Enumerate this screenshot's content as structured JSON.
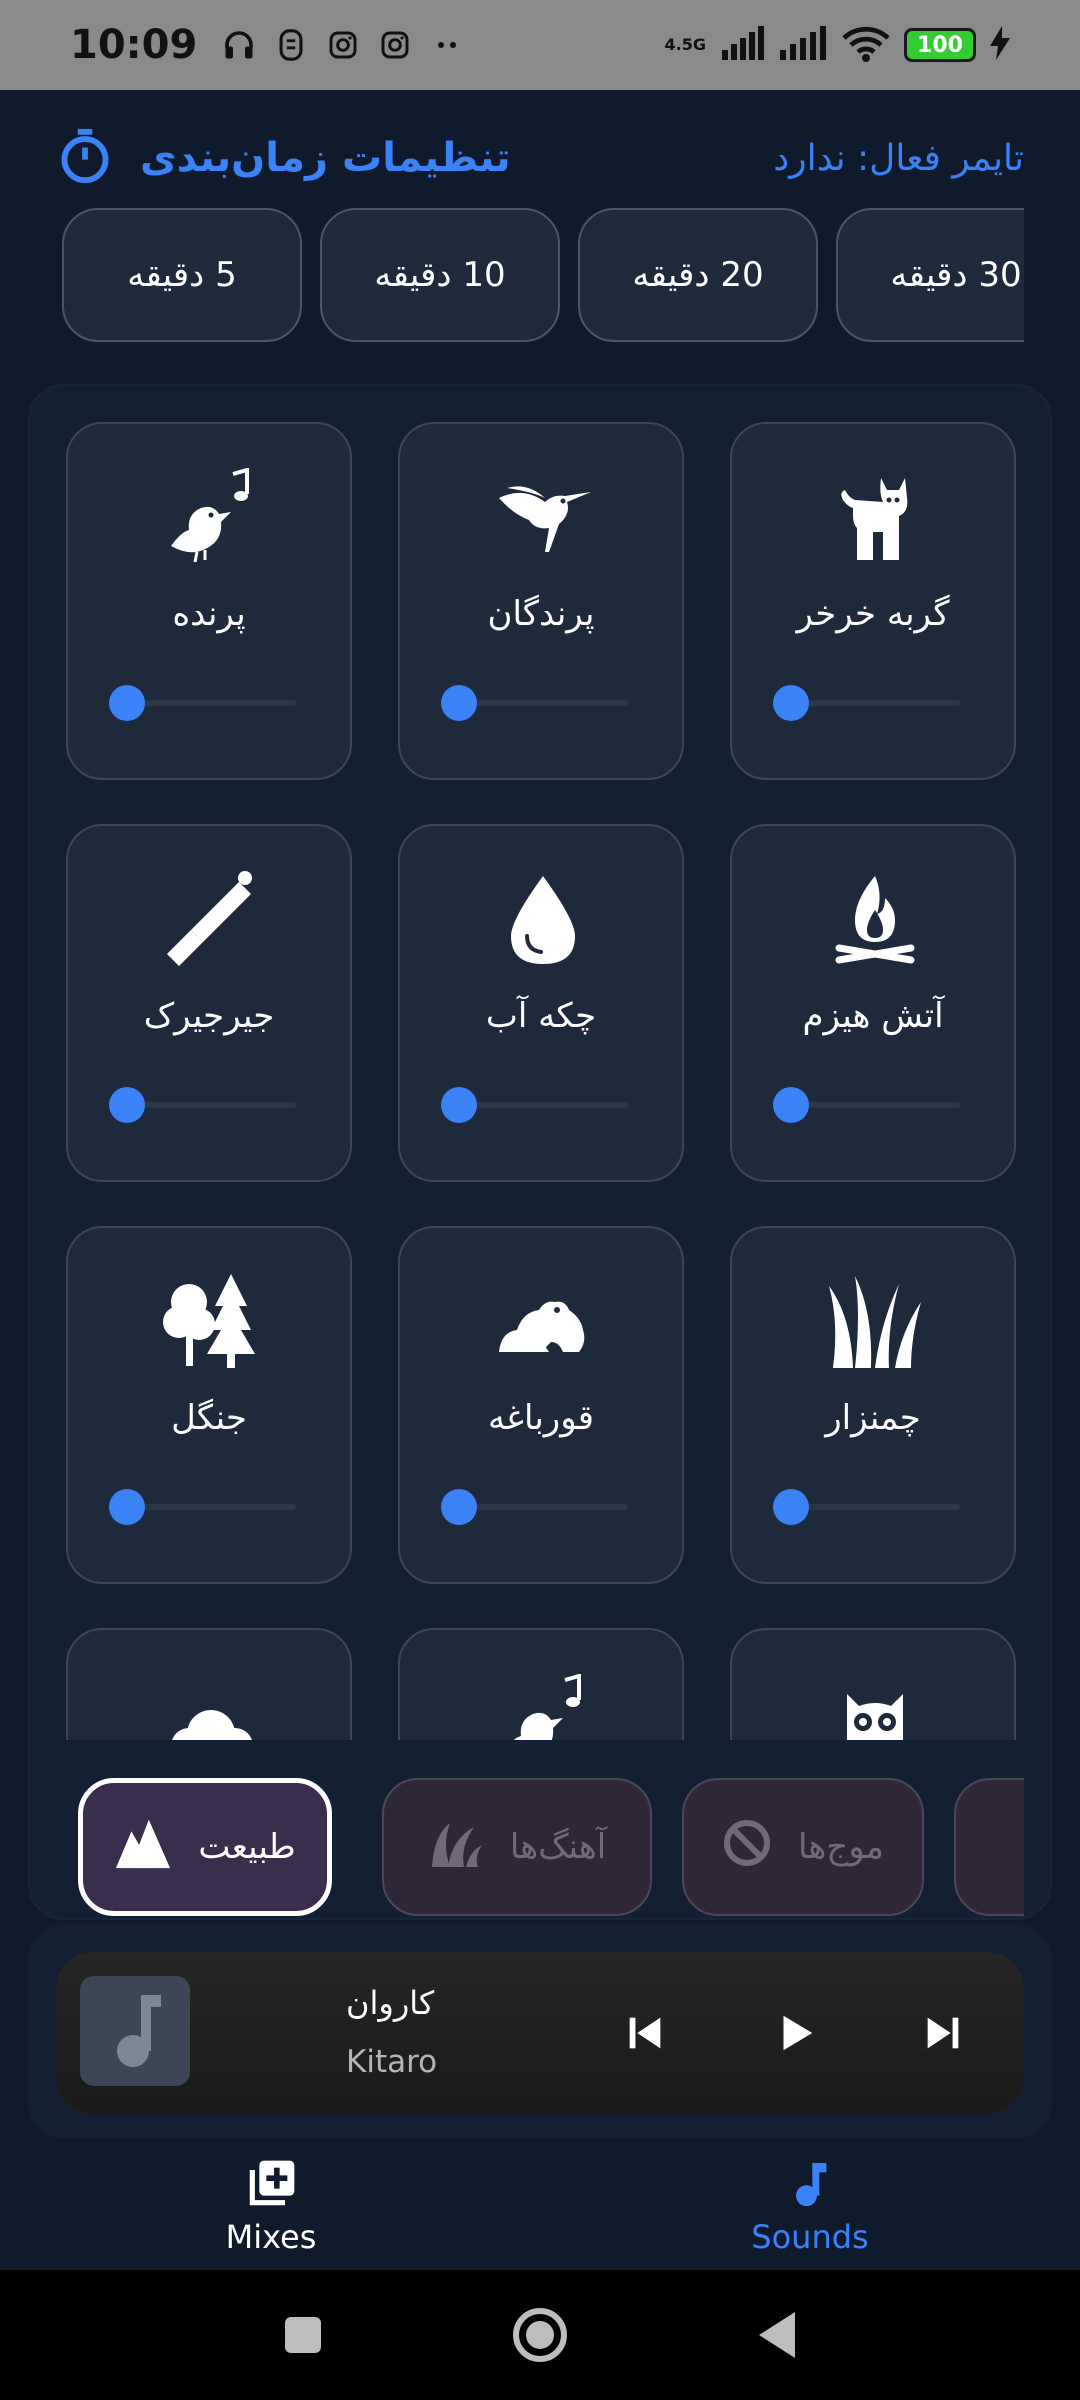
{
  "status_bar": {
    "time": "10:09",
    "network": "4.5G",
    "battery": "100"
  },
  "timer": {
    "title": "تنظیمات زمان‌بندی",
    "active_label": "تایمر فعال: ندارد"
  },
  "timer_options": [
    "5 دقیقه",
    "10 دقیقه",
    "20 دقیقه",
    "30 دقیقه"
  ],
  "sounds": [
    {
      "label": "گربه خرخر",
      "icon": "cat-icon",
      "volume": 0
    },
    {
      "label": "پرندگان",
      "icon": "hummingbird-icon",
      "volume": 0
    },
    {
      "label": "پرنده",
      "icon": "bird-song-icon",
      "volume": 0
    },
    {
      "label": "آتش هیزم",
      "icon": "campfire-icon",
      "volume": 0
    },
    {
      "label": "چکه آب",
      "icon": "water-drop-icon",
      "volume": 0
    },
    {
      "label": "جیرجیرک",
      "icon": "cricket-bat-icon",
      "volume": 0
    },
    {
      "label": "چمنزار",
      "icon": "grass-icon",
      "volume": 0
    },
    {
      "label": "قورباغه",
      "icon": "frog-icon",
      "volume": 0
    },
    {
      "label": "جنگل",
      "icon": "forest-icon",
      "volume": 0
    },
    {
      "label": "",
      "icon": "owl-icon"
    },
    {
      "label": "",
      "icon": "bird-song-icon"
    },
    {
      "label": "",
      "icon": "cloud-icon"
    }
  ],
  "categories": [
    {
      "label": "طبیعت",
      "icon": "mountain-icon",
      "active": true
    },
    {
      "label": "آهنگ‌ها",
      "icon": "leaves-icon",
      "active": false
    },
    {
      "label": "موج‌ها",
      "icon": "block-icon",
      "active": false
    },
    {
      "label": "",
      "icon": "leaves-icon",
      "active": false
    }
  ],
  "player": {
    "title": "کاروان",
    "artist": "Kitaro",
    "art_icon": "music-note-icon"
  },
  "bottom_nav": [
    {
      "label": "Mixes",
      "icon": "add-library-icon",
      "active": false
    },
    {
      "label": "Sounds",
      "icon": "music-note-icon",
      "active": true
    }
  ],
  "colors": {
    "accent": "#3b82f6",
    "background": "#0f1a2c",
    "card": "#1e293b",
    "active_tab": "#3a2e4d"
  }
}
